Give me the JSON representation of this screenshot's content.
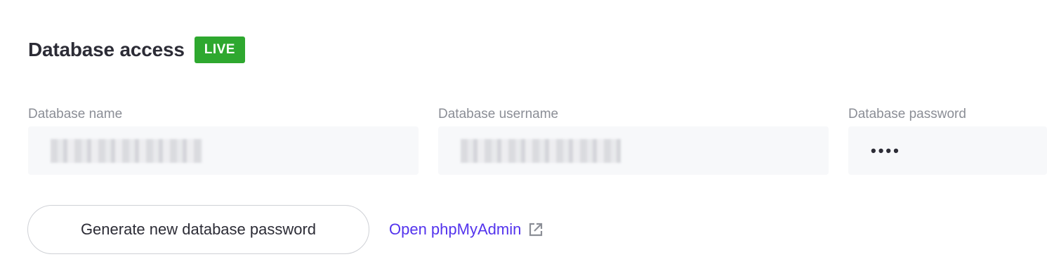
{
  "header": {
    "title": "Database access",
    "badge": "LIVE",
    "badge_color": "#2ea82f"
  },
  "fields": [
    {
      "label": "Database name",
      "value_hidden": true
    },
    {
      "label": "Database username",
      "value_hidden": true
    },
    {
      "label": "Database password",
      "value": "••••"
    }
  ],
  "actions": {
    "generate_label": "Generate new database password",
    "phpmyadmin_label": "Open phpMyAdmin",
    "phpmyadmin_icon": "external-link-icon",
    "link_color": "#5333ed"
  }
}
